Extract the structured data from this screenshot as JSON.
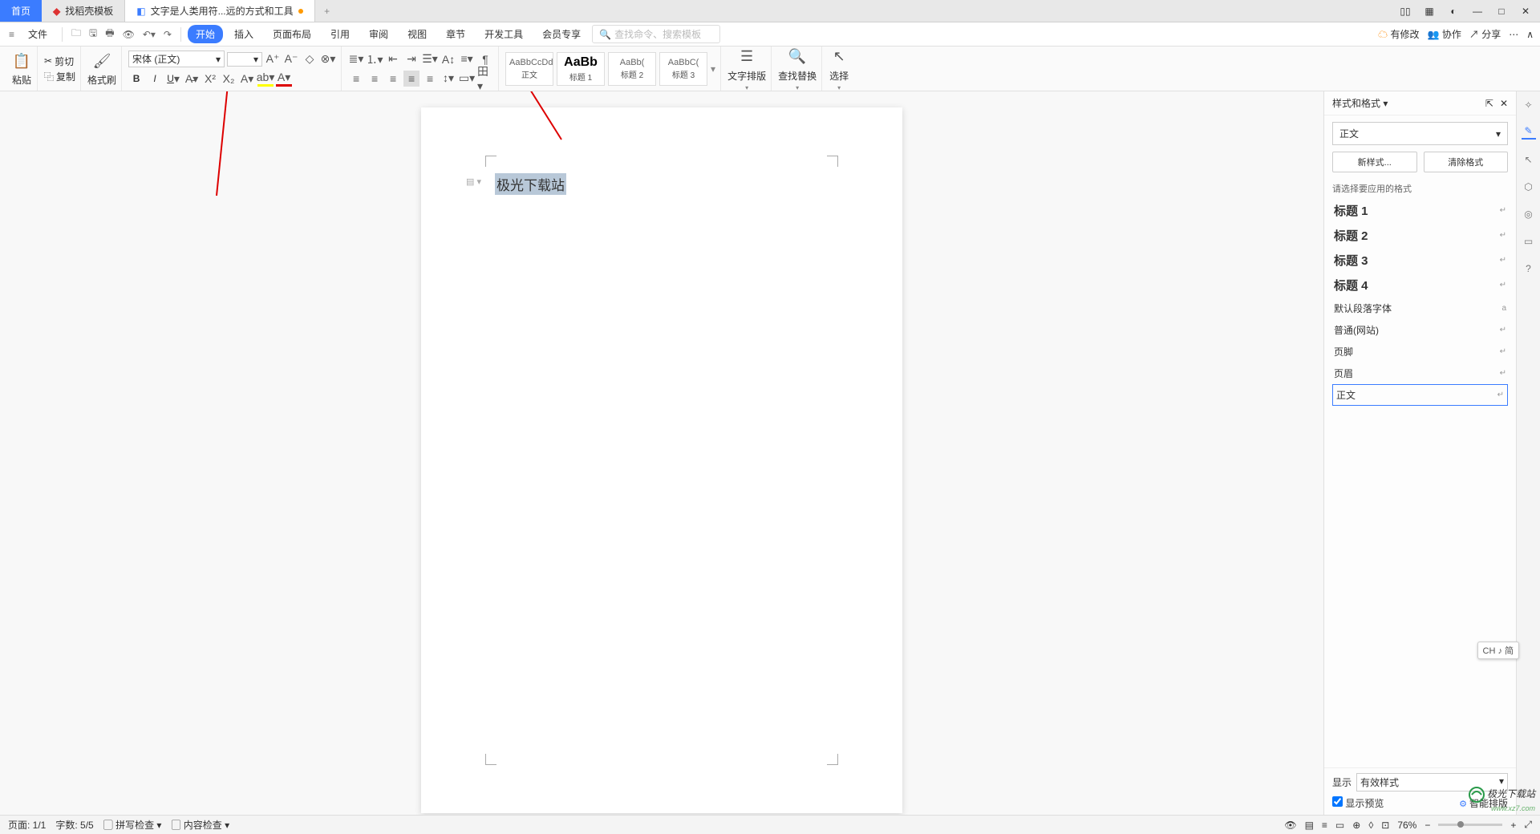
{
  "tabs": {
    "home": "首页",
    "t1": "找稻壳模板",
    "t2": "文字是人类用符...远的方式和工具"
  },
  "menu": {
    "file": "文件",
    "items": [
      "开始",
      "插入",
      "页面布局",
      "引用",
      "审阅",
      "视图",
      "章节",
      "开发工具",
      "会员专享"
    ],
    "search_ph": "查找命令、搜索模板",
    "right": {
      "changes": "有修改",
      "coop": "协作",
      "share": "分享"
    }
  },
  "ribbon": {
    "paste": "粘贴",
    "cut": "剪切",
    "copy": "复制",
    "fmt": "格式刷",
    "font": "宋体 (正文)",
    "size": "",
    "styles": [
      {
        "prev": "AaBbCcDd",
        "lbl": "正文"
      },
      {
        "prev": "AaBb",
        "lbl": "标题 1"
      },
      {
        "prev": "AaBb(",
        "lbl": "标题 2"
      },
      {
        "prev": "AaBbC(",
        "lbl": "标题 3"
      }
    ],
    "layout": "文字排版",
    "find": "查找替换",
    "select": "选择"
  },
  "doc": {
    "text": "极光下载站"
  },
  "panel": {
    "title": "样式和格式",
    "current": "正文",
    "new": "新样式...",
    "clear": "清除格式",
    "prompt": "请选择要应用的格式",
    "list": [
      {
        "n": "标题 1",
        "b": true
      },
      {
        "n": "标题 2",
        "b": true
      },
      {
        "n": "标题 3",
        "b": true
      },
      {
        "n": "标题 4",
        "b": true
      },
      {
        "n": "默认段落字体",
        "b": false,
        "mk": "a"
      },
      {
        "n": "普通(网站)",
        "b": false
      },
      {
        "n": "页脚",
        "b": false
      },
      {
        "n": "页眉",
        "b": false
      },
      {
        "n": "正文",
        "b": false,
        "sel": true
      }
    ],
    "show": "显示",
    "showval": "有效样式",
    "preview": "显示预览",
    "smart": "智能排版"
  },
  "ime": "CH ♪ 简",
  "status": {
    "page": "页面: 1/1",
    "words": "字数: 5/5",
    "spell": "拼写检查",
    "content": "内容检查",
    "zoom": "76%"
  },
  "watermark": {
    "name": "极光下载站",
    "url": "www.xz7.com"
  }
}
